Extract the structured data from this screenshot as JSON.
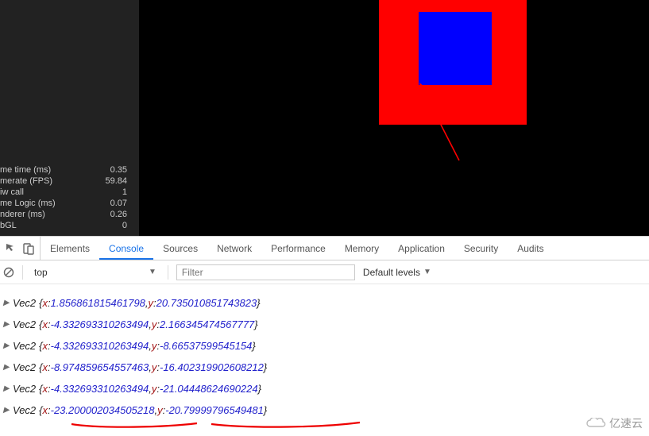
{
  "preview": {
    "stats": [
      {
        "label": "me time (ms)",
        "value": "0.35"
      },
      {
        "label": "merate (FPS)",
        "value": "59.84"
      },
      {
        "label": "iw call",
        "value": "1"
      },
      {
        "label": "me Logic (ms)",
        "value": "0.07"
      },
      {
        "label": "nderer (ms)",
        "value": "0.26"
      },
      {
        "label": "bGL",
        "value": "0"
      }
    ],
    "colors": {
      "red": "#ff0000",
      "blue": "#0000ff",
      "annotation": "#ff0000"
    }
  },
  "devtools": {
    "tabs": [
      "Elements",
      "Console",
      "Sources",
      "Network",
      "Performance",
      "Memory",
      "Application",
      "Security",
      "Audits"
    ],
    "active_tab": "Console",
    "filter": {
      "scope": "top",
      "placeholder": "Filter",
      "levels": "Default levels"
    },
    "logs": [
      {
        "type": "Vec2",
        "x": "1.856861815461798",
        "y": "20.735010851743823"
      },
      {
        "type": "Vec2",
        "x": "-4.332693310263494",
        "y": "2.166345474567777"
      },
      {
        "type": "Vec2",
        "x": "-4.332693310263494",
        "y": "-8.66537599545154"
      },
      {
        "type": "Vec2",
        "x": "-8.974859654557463",
        "y": "-16.402319902608212"
      },
      {
        "type": "Vec2",
        "x": "-4.332693310263494",
        "y": "-21.04448624690224"
      },
      {
        "type": "Vec2",
        "x": "-23.200002034505218",
        "y": "-20.79999796549481"
      }
    ]
  },
  "watermark": {
    "label": "亿速云"
  },
  "icons": {
    "device": "device-icon",
    "select": "select-element-icon",
    "clear": "clear-console-icon",
    "dropdown": "chevron-down-icon",
    "expander": "expander-triangle-icon"
  }
}
